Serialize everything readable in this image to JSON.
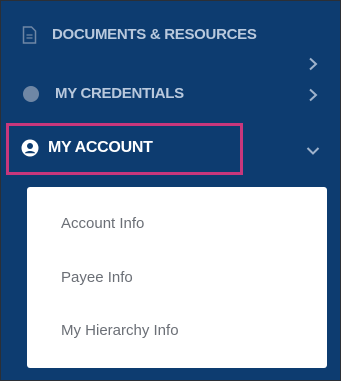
{
  "nav": {
    "documents": {
      "label": "DOCUMENTS & RESOURCES",
      "icon": "document-icon"
    },
    "credentials": {
      "label": "MY CREDENTIALS",
      "icon": "circle-icon"
    },
    "account": {
      "label": "MY ACCOUNT",
      "icon": "user-circle-icon",
      "expanded": true,
      "highlight_color": "#c8377c"
    }
  },
  "submenu": {
    "items": [
      {
        "label": "Account Info"
      },
      {
        "label": "Payee Info"
      },
      {
        "label": "My Hierarchy Info"
      }
    ]
  },
  "colors": {
    "sidebar_bg": "#0d3c70",
    "nav_text": "#b9c9dd",
    "active_text": "#ffffff",
    "submenu_bg": "#ffffff",
    "submenu_text": "#6b6f76"
  }
}
